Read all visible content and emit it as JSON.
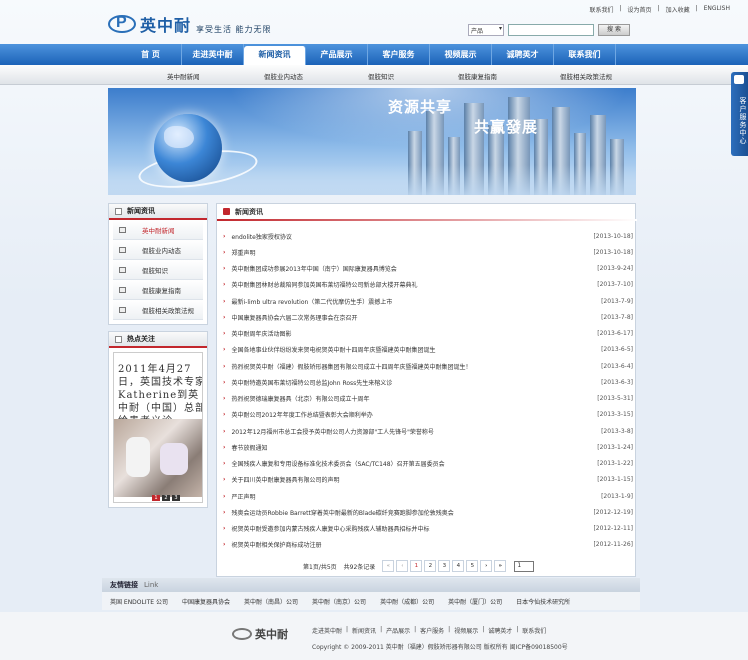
{
  "brand": {
    "name": "英中耐",
    "slogan": "享受生活  能力无限"
  },
  "top_links": [
    "联系我们",
    "|",
    "设为首页",
    "|",
    "加入收藏",
    "|",
    "ENGLISH"
  ],
  "search": {
    "select_value": "产品",
    "button": "搜 索"
  },
  "nav": [
    "首 页",
    "走进英中耐",
    "新闻资讯",
    "产品展示",
    "客户服务",
    "视频展示",
    "诚聘英才",
    "联系我们"
  ],
  "nav_active": 2,
  "subnav": [
    "英中耐新闻",
    "假肢业内动态",
    "假肢知识",
    "假肢康复指南",
    "假肢相关政策法规"
  ],
  "banner": {
    "line1": "资源共享",
    "line2": "共赢發展"
  },
  "sidebar": {
    "title": "新闻资讯",
    "items": [
      "英中耐新闻",
      "假肢业内动态",
      "假肢知识",
      "假肢康复指南",
      "假肢相关政策法规"
    ],
    "hot_title": "热点关注",
    "hot_text": "2011年4月27日，英国技术专家Katherine到英中耐（中国）总部给患者义诊。",
    "hot_pages": [
      "1",
      "2",
      "3"
    ]
  },
  "main": {
    "title": "新闻资讯",
    "news": [
      {
        "title": "endolite独家授权协议",
        "date": "[2013-10-18]"
      },
      {
        "title": "郑重声明",
        "date": "[2013-10-18]"
      },
      {
        "title": "英中耐集团成功参展2013年中国（南宁）国际康复器具博览会",
        "date": "[2013-9-24]"
      },
      {
        "title": "英中耐集团林财总裁陪同参加英国布莱切福特公司新总部大楼开幕典礼",
        "date": "[2013-7-10]"
      },
      {
        "title": "最新i-limb ultra revolution（第二代优摩仿生手）震撼上市",
        "date": "[2013-7-9]"
      },
      {
        "title": "中国康复器具协会六届二次常务理事会在京召开",
        "date": "[2013-7-8]"
      },
      {
        "title": "英中耐周年庆活动图影",
        "date": "[2013-6-17]"
      },
      {
        "title": "全国各地事业伙伴纷纷发来贺电祝贺英中耐十四周年庆暨福建英中耐集团诞生",
        "date": "[2013-6-5]"
      },
      {
        "title": "热烈祝贺英中耐（福建）假肢矫形器集团有限公司成立十四周年庆暨福建英中耐集团诞生！",
        "date": "[2013-6-4]"
      },
      {
        "title": "英中耐特邀英国布莱切福特公司总监John Ross先生来榕义诊",
        "date": "[2013-6-3]"
      },
      {
        "title": "热烈祝贺德瑞康复器具（北京）有限公司成立十周年",
        "date": "[2013-5-31]"
      },
      {
        "title": "英中耐公司2012年年度工作总结暨表彰大会顺利举办",
        "date": "[2013-3-15]"
      },
      {
        "title": "2012年12月福州市总工会授予英中耐公司人力资源部\"工人先锋号\"荣誉称号",
        "date": "[2013-3-8]"
      },
      {
        "title": "春节放假通知",
        "date": "[2013-1-24]"
      },
      {
        "title": "全国残疾人康复和专用设备标准化技术委员会（SAC/TC148）召开第五届委员会",
        "date": "[2013-1-22]"
      },
      {
        "title": "关于四川英中耐康复器具有限公司的声明",
        "date": "[2013-1-15]"
      },
      {
        "title": "严正声明",
        "date": "[2013-1-9]"
      },
      {
        "title": "残奥会运动员Robbie Barrett穿着英中耐最新的Blade碳纤竞赛跑脚参加伦敦残奥会",
        "date": "[2012-12-19]"
      },
      {
        "title": "祝贺英中耐受邀参加内蒙古残疾人康复中心采购残疾人辅助器具招标并中标",
        "date": "[2012-12-11]"
      },
      {
        "title": "祝贺英中耐相关保护商标成功注册",
        "date": "[2012-11-26]"
      }
    ],
    "pager": {
      "info": "第1页/共5页",
      "count": "共92条记录",
      "pages": [
        "1",
        "2",
        "3",
        "4",
        "5"
      ],
      "select": "1"
    }
  },
  "friends": {
    "title": "友情链接",
    "sub": "Link",
    "links": [
      "英国 ENDOLITE 公司",
      "中国康复器具协会",
      "英中耐（南昌）公司",
      "英中耐（南京）公司",
      "英中耐（成都）公司",
      "英中耐（厦门）公司",
      "日本今仙技术研究所"
    ]
  },
  "footer": {
    "links": [
      "走进英中耐",
      "|",
      "新闻资讯",
      "|",
      "产品展示",
      "|",
      "客户服务",
      "|",
      "视频展示",
      "|",
      "诚聘英才",
      "|",
      "联系我们"
    ],
    "copyright": "Copyright © 2009-2011 英中耐（福建）假肢矫形器有限公司 版权所有 闽ICP备09018500号"
  },
  "side_float": "客户服务中心"
}
